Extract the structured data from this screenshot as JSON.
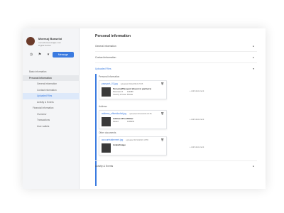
{
  "profile": {
    "name": "Moresoj Busseloi",
    "email": "moresbussesss@e.com",
    "role": "Digital Debtor",
    "message_label": "Message"
  },
  "icons": {
    "clock": "clock-icon",
    "flag": "flag-icon",
    "caret": "caret-down-icon"
  },
  "nav": [
    {
      "label": "Basic information",
      "level": 0,
      "state": "normal"
    },
    {
      "label": "Personal Information",
      "level": 0,
      "state": "header"
    },
    {
      "label": "General information",
      "level": 1,
      "state": "normal"
    },
    {
      "label": "Contact information",
      "level": 1,
      "state": "normal"
    },
    {
      "label": "Uploaded Files",
      "level": 1,
      "state": "active"
    },
    {
      "label": "Activity & Events",
      "level": 0,
      "state": "normal"
    },
    {
      "label": "Financial information",
      "level": 0,
      "state": "normal"
    },
    {
      "label": "Overview",
      "level": 1,
      "state": "normal"
    },
    {
      "label": "Transactions",
      "level": 1,
      "state": "normal"
    },
    {
      "label": "User wallets",
      "level": 1,
      "state": "normal"
    }
  ],
  "main": {
    "title": "Personal information",
    "accordions": {
      "general": "General information",
      "contact": "Contact information",
      "uploaded": "Uploaded Files",
      "activity": "Activity & Events"
    },
    "sections": {
      "personal": "Personal information",
      "address": "Address",
      "other": "Other documents"
    },
    "add_document": "+ Add document",
    "cards": {
      "passport": {
        "file": "passport_01.jpg",
        "uploaded": "uploaded 03/12/2016 15:55",
        "title": "Personal/Passport (Guest in partners)",
        "rows": [
          {
            "k": "Document #",
            "v": "123456"
          },
          {
            "k": "Country of issue",
            "v": "Russia"
          }
        ]
      },
      "address": {
        "file": "address_offsetdoclist.jpg",
        "uploaded": "uploaded 03/12/2016 15:55",
        "title": "Address/ProofOther",
        "rows": [
          {
            "k": "Issued",
            "v": "12/08/16"
          }
        ]
      },
      "other": {
        "file": "accountstatement.jpg",
        "uploaded": "uploaded 03/12/2016 15:55",
        "title": "AvatarImage",
        "rows": []
      }
    }
  }
}
